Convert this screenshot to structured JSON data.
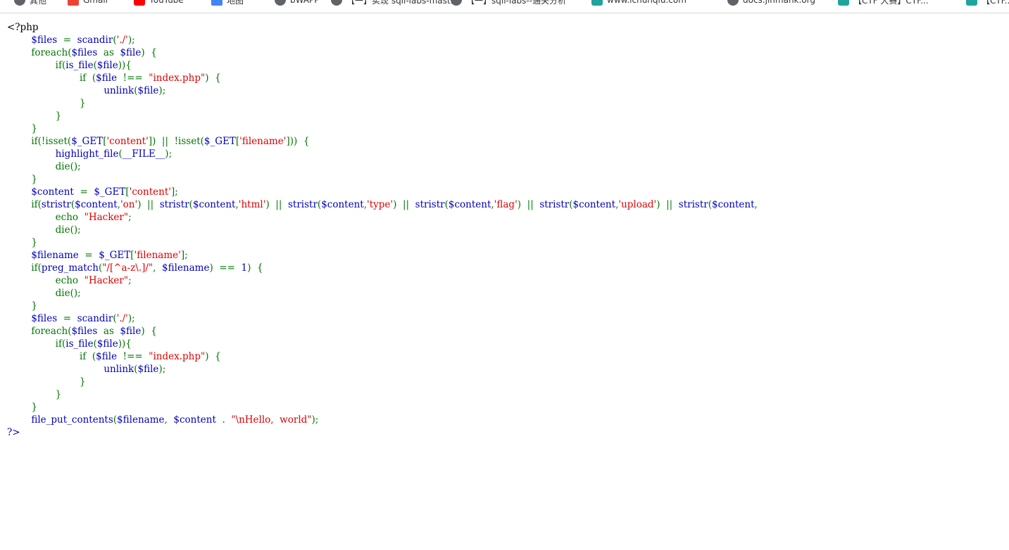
{
  "bookmarks": [
    {
      "label": "其他",
      "icon": "globe-icon"
    },
    {
      "label": "Gmail",
      "icon": "gmail-icon"
    },
    {
      "label": "YouTube",
      "icon": "youtube-icon"
    },
    {
      "label": "地图",
      "icon": "maps-icon"
    },
    {
      "label": "bWAPP",
      "icon": "globe-icon"
    },
    {
      "label": "【一】实现 sqli-labs-mast...",
      "icon": "globe-icon"
    },
    {
      "label": "【一】sqli-labs--通关分析",
      "icon": "globe-icon"
    },
    {
      "label": "www.ichunqiu.com",
      "icon": "bookmark-icon"
    },
    {
      "label": "docs.jinmahk.org",
      "icon": "globe-icon"
    },
    {
      "label": "【CTF 大赛】CTF...",
      "icon": "bookmark-icon"
    },
    {
      "label": "【CTF...",
      "icon": "bookmark-icon"
    }
  ],
  "code": {
    "colors": {
      "html": "#000000",
      "default": "#0000bb",
      "keyword": "#007700",
      "string": "#dd0000"
    },
    "lines": [
      [
        {
          "t": "<?php",
          "c": "html"
        }
      ],
      [
        {
          "t": "        ",
          "c": "default"
        },
        {
          "t": "$files",
          "c": "default"
        },
        {
          "t": "  =  ",
          "c": "keyword"
        },
        {
          "t": "scandir",
          "c": "default"
        },
        {
          "t": "(",
          "c": "keyword"
        },
        {
          "t": "'./'",
          "c": "string"
        },
        {
          "t": ");",
          "c": "keyword"
        }
      ],
      [
        {
          "t": "        foreach(",
          "c": "keyword"
        },
        {
          "t": "$files  ",
          "c": "default"
        },
        {
          "t": "as  ",
          "c": "keyword"
        },
        {
          "t": "$file",
          "c": "default"
        },
        {
          "t": ")  {",
          "c": "keyword"
        }
      ],
      [
        {
          "t": "                if(",
          "c": "keyword"
        },
        {
          "t": "is_file",
          "c": "default"
        },
        {
          "t": "(",
          "c": "keyword"
        },
        {
          "t": "$file",
          "c": "default"
        },
        {
          "t": ")){",
          "c": "keyword"
        }
      ],
      [
        {
          "t": "                        if  (",
          "c": "keyword"
        },
        {
          "t": "$file  ",
          "c": "default"
        },
        {
          "t": "!==  ",
          "c": "keyword"
        },
        {
          "t": "\"index.php\"",
          "c": "string"
        },
        {
          "t": ")  {",
          "c": "keyword"
        }
      ],
      [
        {
          "t": "                                ",
          "c": "keyword"
        },
        {
          "t": "unlink",
          "c": "default"
        },
        {
          "t": "(",
          "c": "keyword"
        },
        {
          "t": "$file",
          "c": "default"
        },
        {
          "t": ");",
          "c": "keyword"
        }
      ],
      [
        {
          "t": "                        }",
          "c": "keyword"
        }
      ],
      [
        {
          "t": "                }",
          "c": "keyword"
        }
      ],
      [
        {
          "t": "        }",
          "c": "keyword"
        }
      ],
      [
        {
          "t": "        if(!isset(",
          "c": "keyword"
        },
        {
          "t": "$_GET",
          "c": "default"
        },
        {
          "t": "[",
          "c": "keyword"
        },
        {
          "t": "'content'",
          "c": "string"
        },
        {
          "t": "])  ||  !isset(",
          "c": "keyword"
        },
        {
          "t": "$_GET",
          "c": "default"
        },
        {
          "t": "[",
          "c": "keyword"
        },
        {
          "t": "'filename'",
          "c": "string"
        },
        {
          "t": "]))  {",
          "c": "keyword"
        }
      ],
      [
        {
          "t": "                ",
          "c": "keyword"
        },
        {
          "t": "highlight_file",
          "c": "default"
        },
        {
          "t": "(",
          "c": "keyword"
        },
        {
          "t": "__FILE__",
          "c": "default"
        },
        {
          "t": ");",
          "c": "keyword"
        }
      ],
      [
        {
          "t": "                die();",
          "c": "keyword"
        }
      ],
      [
        {
          "t": "        }",
          "c": "keyword"
        }
      ],
      [
        {
          "t": "        ",
          "c": "default"
        },
        {
          "t": "$content  ",
          "c": "default"
        },
        {
          "t": "=  ",
          "c": "keyword"
        },
        {
          "t": "$_GET",
          "c": "default"
        },
        {
          "t": "[",
          "c": "keyword"
        },
        {
          "t": "'content'",
          "c": "string"
        },
        {
          "t": "];",
          "c": "keyword"
        }
      ],
      [
        {
          "t": "        if(",
          "c": "keyword"
        },
        {
          "t": "stristr",
          "c": "default"
        },
        {
          "t": "(",
          "c": "keyword"
        },
        {
          "t": "$content",
          "c": "default"
        },
        {
          "t": ",",
          "c": "keyword"
        },
        {
          "t": "'on'",
          "c": "string"
        },
        {
          "t": ")  ||  ",
          "c": "keyword"
        },
        {
          "t": "stristr",
          "c": "default"
        },
        {
          "t": "(",
          "c": "keyword"
        },
        {
          "t": "$content",
          "c": "default"
        },
        {
          "t": ",",
          "c": "keyword"
        },
        {
          "t": "'html'",
          "c": "string"
        },
        {
          "t": ")  ||  ",
          "c": "keyword"
        },
        {
          "t": "stristr",
          "c": "default"
        },
        {
          "t": "(",
          "c": "keyword"
        },
        {
          "t": "$content",
          "c": "default"
        },
        {
          "t": ",",
          "c": "keyword"
        },
        {
          "t": "'type'",
          "c": "string"
        },
        {
          "t": ")  ||  ",
          "c": "keyword"
        },
        {
          "t": "stristr",
          "c": "default"
        },
        {
          "t": "(",
          "c": "keyword"
        },
        {
          "t": "$content",
          "c": "default"
        },
        {
          "t": ",",
          "c": "keyword"
        },
        {
          "t": "'flag'",
          "c": "string"
        },
        {
          "t": ")  ||  ",
          "c": "keyword"
        },
        {
          "t": "stristr",
          "c": "default"
        },
        {
          "t": "(",
          "c": "keyword"
        },
        {
          "t": "$content",
          "c": "default"
        },
        {
          "t": ",",
          "c": "keyword"
        },
        {
          "t": "'upload'",
          "c": "string"
        },
        {
          "t": ")  ||  ",
          "c": "keyword"
        },
        {
          "t": "stristr",
          "c": "default"
        },
        {
          "t": "(",
          "c": "keyword"
        },
        {
          "t": "$content",
          "c": "default"
        },
        {
          "t": ",",
          "c": "keyword"
        }
      ],
      [
        {
          "t": "                echo  ",
          "c": "keyword"
        },
        {
          "t": "\"Hacker\"",
          "c": "string"
        },
        {
          "t": ";",
          "c": "keyword"
        }
      ],
      [
        {
          "t": "                die();",
          "c": "keyword"
        }
      ],
      [
        {
          "t": "        }",
          "c": "keyword"
        }
      ],
      [
        {
          "t": "        ",
          "c": "default"
        },
        {
          "t": "$filename  ",
          "c": "default"
        },
        {
          "t": "=  ",
          "c": "keyword"
        },
        {
          "t": "$_GET",
          "c": "default"
        },
        {
          "t": "[",
          "c": "keyword"
        },
        {
          "t": "'filename'",
          "c": "string"
        },
        {
          "t": "];",
          "c": "keyword"
        }
      ],
      [
        {
          "t": "        if(",
          "c": "keyword"
        },
        {
          "t": "preg_match",
          "c": "default"
        },
        {
          "t": "(",
          "c": "keyword"
        },
        {
          "t": "\"/[^a-z\\.]/\"",
          "c": "string"
        },
        {
          "t": ",  ",
          "c": "keyword"
        },
        {
          "t": "$filename",
          "c": "default"
        },
        {
          "t": ")  ==  ",
          "c": "keyword"
        },
        {
          "t": "1",
          "c": "default"
        },
        {
          "t": ")  {",
          "c": "keyword"
        }
      ],
      [
        {
          "t": "                echo  ",
          "c": "keyword"
        },
        {
          "t": "\"Hacker\"",
          "c": "string"
        },
        {
          "t": ";",
          "c": "keyword"
        }
      ],
      [
        {
          "t": "                die();",
          "c": "keyword"
        }
      ],
      [
        {
          "t": "        }",
          "c": "keyword"
        }
      ],
      [
        {
          "t": "        ",
          "c": "default"
        },
        {
          "t": "$files",
          "c": "default"
        },
        {
          "t": "  =  ",
          "c": "keyword"
        },
        {
          "t": "scandir",
          "c": "default"
        },
        {
          "t": "(",
          "c": "keyword"
        },
        {
          "t": "'./'",
          "c": "string"
        },
        {
          "t": ");",
          "c": "keyword"
        }
      ],
      [
        {
          "t": "        foreach(",
          "c": "keyword"
        },
        {
          "t": "$files  ",
          "c": "default"
        },
        {
          "t": "as  ",
          "c": "keyword"
        },
        {
          "t": "$file",
          "c": "default"
        },
        {
          "t": ")  {",
          "c": "keyword"
        }
      ],
      [
        {
          "t": "                if(",
          "c": "keyword"
        },
        {
          "t": "is_file",
          "c": "default"
        },
        {
          "t": "(",
          "c": "keyword"
        },
        {
          "t": "$file",
          "c": "default"
        },
        {
          "t": ")){",
          "c": "keyword"
        }
      ],
      [
        {
          "t": "                        if  (",
          "c": "keyword"
        },
        {
          "t": "$file  ",
          "c": "default"
        },
        {
          "t": "!==  ",
          "c": "keyword"
        },
        {
          "t": "\"index.php\"",
          "c": "string"
        },
        {
          "t": ")  {",
          "c": "keyword"
        }
      ],
      [
        {
          "t": "                                ",
          "c": "keyword"
        },
        {
          "t": "unlink",
          "c": "default"
        },
        {
          "t": "(",
          "c": "keyword"
        },
        {
          "t": "$file",
          "c": "default"
        },
        {
          "t": ");",
          "c": "keyword"
        }
      ],
      [
        {
          "t": "                        }",
          "c": "keyword"
        }
      ],
      [
        {
          "t": "                }",
          "c": "keyword"
        }
      ],
      [
        {
          "t": "        }",
          "c": "keyword"
        }
      ],
      [
        {
          "t": "        ",
          "c": "default"
        },
        {
          "t": "file_put_contents",
          "c": "default"
        },
        {
          "t": "(",
          "c": "keyword"
        },
        {
          "t": "$filename",
          "c": "default"
        },
        {
          "t": ",  ",
          "c": "keyword"
        },
        {
          "t": "$content  ",
          "c": "default"
        },
        {
          "t": ".  ",
          "c": "keyword"
        },
        {
          "t": "\"\\nHello,  world\"",
          "c": "string"
        },
        {
          "t": ");",
          "c": "keyword"
        }
      ],
      [
        {
          "t": "?>",
          "c": "default"
        }
      ]
    ]
  }
}
